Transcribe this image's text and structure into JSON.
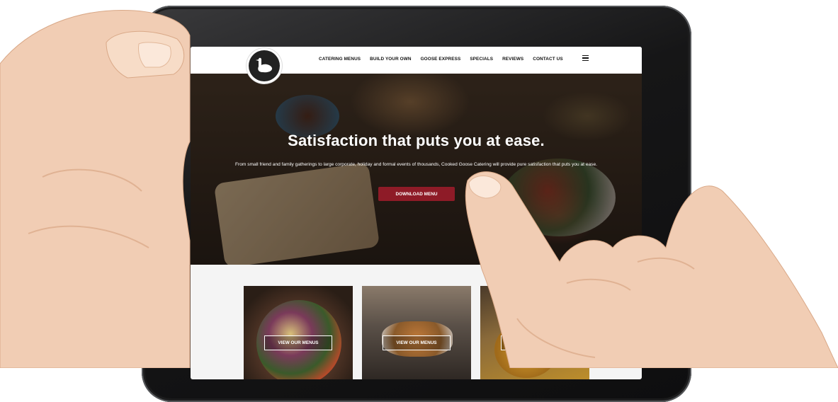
{
  "site": {
    "nav": [
      "CATERING MENUS",
      "BUILD YOUR OWN",
      "GOOSE EXPRESS",
      "SPECIALS",
      "REVIEWS",
      "CONTACT US"
    ]
  },
  "hero": {
    "title": "Satisfaction that puts you at ease.",
    "text": "From small friend and family gatherings to large corporate, holiday and formal events of thousands, Cooked Goose Catering will provide pure satisfaction that puts you at ease.",
    "button": "DOWNLOAD MENU"
  },
  "cards": [
    {
      "button": "VIEW OUR MENUS"
    },
    {
      "button": "VIEW OUR MENUS"
    },
    {
      "button": "OR"
    }
  ],
  "colors": {
    "accent": "#8e1b27",
    "header_bg": "#ffffff"
  },
  "icons": {
    "menu": "hamburger-menu-icon",
    "logo": "goose-logo-icon"
  }
}
